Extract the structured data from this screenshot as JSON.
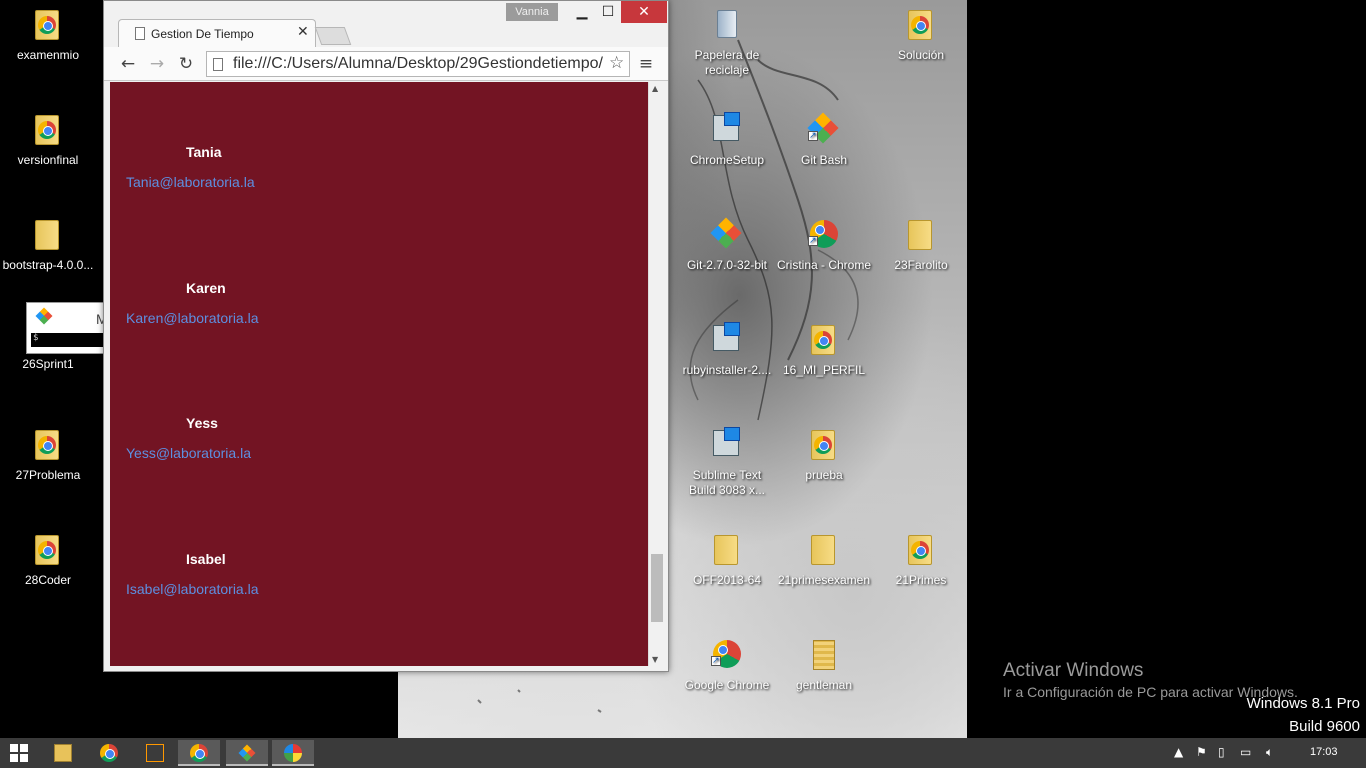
{
  "desktop": {
    "left_icons": [
      {
        "label": "examenmio",
        "kind": "folder-chrome"
      },
      {
        "label": "versionfinal",
        "kind": "folder-chrome"
      },
      {
        "label": "bootstrap-4.0.0...",
        "kind": "folder"
      },
      {
        "label": "26Sprint1",
        "kind": "gitbash-window"
      },
      {
        "label": "27Problema",
        "kind": "folder-chrome"
      },
      {
        "label": "28Coder",
        "kind": "folder-chrome"
      }
    ],
    "git_window": {
      "title_fragment": "M",
      "prompt": "$"
    },
    "right_icons": [
      {
        "label": "Papelera de reciclaje",
        "kind": "recycle-bin"
      },
      {
        "label": "Solución",
        "kind": "folder-chrome"
      },
      {
        "label": "ChromeSetup",
        "kind": "installer"
      },
      {
        "label": "Git Bash",
        "kind": "git"
      },
      {
        "label": "Git-2.7.0-32-bit",
        "kind": "git"
      },
      {
        "label": "Cristina - Chrome",
        "kind": "chrome"
      },
      {
        "label": "23Farolito",
        "kind": "folder"
      },
      {
        "label": "rubyinstaller-2....",
        "kind": "installer"
      },
      {
        "label": "16_MI_PERFIL",
        "kind": "folder-chrome"
      },
      {
        "label": "Sublime Text Build 3083 x...",
        "kind": "installer"
      },
      {
        "label": "prueba",
        "kind": "folder-chrome"
      },
      {
        "label": "OFF2013-64",
        "kind": "folder"
      },
      {
        "label": "21primesexamen",
        "kind": "folder"
      },
      {
        "label": "21Primes",
        "kind": "folder-chrome"
      },
      {
        "label": "Google Chrome",
        "kind": "chrome"
      },
      {
        "label": "gentleman",
        "kind": "zip"
      }
    ],
    "activation": {
      "title": "Activar Windows",
      "subtitle": "Ir a Configuración de PC para activar Windows."
    },
    "os_version": {
      "line1": "Windows 8.1 Pro",
      "line2": "Build 9600"
    }
  },
  "browser": {
    "profile_name": "Vannia",
    "tab_title": "Gestion De Tiempo",
    "url": "file:///C:/Users/Alumna/Desktop/29Gestiondetiempo/",
    "page": {
      "background": "#731423",
      "contacts": [
        {
          "name": "Tania",
          "email": "Tania@laboratoria.la"
        },
        {
          "name": "Karen",
          "email": "Karen@laboratoria.la"
        },
        {
          "name": "Yess",
          "email": "Yess@laboratoria.la"
        },
        {
          "name": "Isabel",
          "email": "Isabel@laboratoria.la"
        }
      ]
    }
  },
  "taskbar": {
    "apps": [
      "file-explorer-icon",
      "chrome-icon",
      "sublime-text-icon",
      "chrome-app-icon",
      "git-bash-icon",
      "paint-icon"
    ],
    "clock": "17:03"
  }
}
